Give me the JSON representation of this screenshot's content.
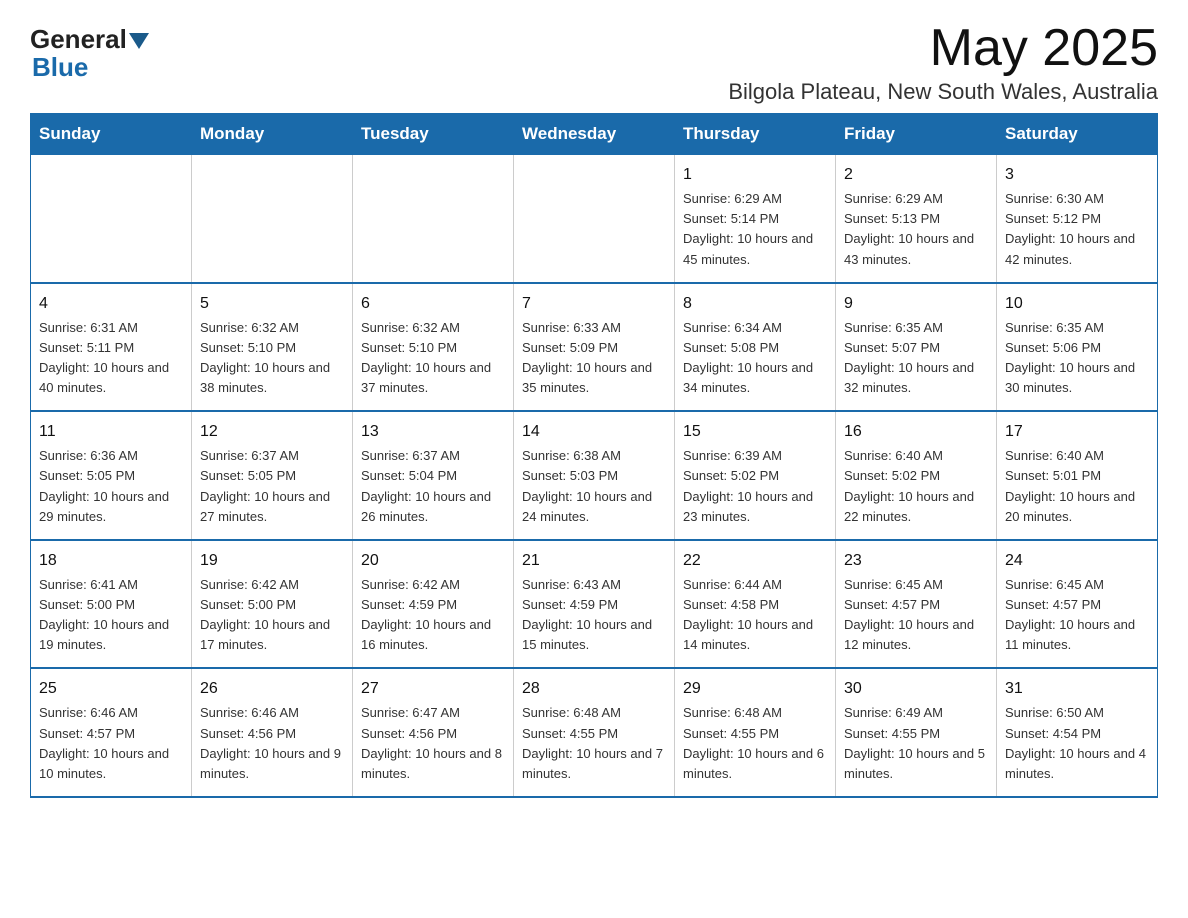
{
  "logo": {
    "general": "General",
    "blue": "Blue"
  },
  "title": {
    "month_year": "May 2025",
    "location": "Bilgola Plateau, New South Wales, Australia"
  },
  "days_of_week": [
    "Sunday",
    "Monday",
    "Tuesday",
    "Wednesday",
    "Thursday",
    "Friday",
    "Saturday"
  ],
  "weeks": [
    [
      {
        "day": "",
        "info": ""
      },
      {
        "day": "",
        "info": ""
      },
      {
        "day": "",
        "info": ""
      },
      {
        "day": "",
        "info": ""
      },
      {
        "day": "1",
        "info": "Sunrise: 6:29 AM\nSunset: 5:14 PM\nDaylight: 10 hours and 45 minutes."
      },
      {
        "day": "2",
        "info": "Sunrise: 6:29 AM\nSunset: 5:13 PM\nDaylight: 10 hours and 43 minutes."
      },
      {
        "day": "3",
        "info": "Sunrise: 6:30 AM\nSunset: 5:12 PM\nDaylight: 10 hours and 42 minutes."
      }
    ],
    [
      {
        "day": "4",
        "info": "Sunrise: 6:31 AM\nSunset: 5:11 PM\nDaylight: 10 hours and 40 minutes."
      },
      {
        "day": "5",
        "info": "Sunrise: 6:32 AM\nSunset: 5:10 PM\nDaylight: 10 hours and 38 minutes."
      },
      {
        "day": "6",
        "info": "Sunrise: 6:32 AM\nSunset: 5:10 PM\nDaylight: 10 hours and 37 minutes."
      },
      {
        "day": "7",
        "info": "Sunrise: 6:33 AM\nSunset: 5:09 PM\nDaylight: 10 hours and 35 minutes."
      },
      {
        "day": "8",
        "info": "Sunrise: 6:34 AM\nSunset: 5:08 PM\nDaylight: 10 hours and 34 minutes."
      },
      {
        "day": "9",
        "info": "Sunrise: 6:35 AM\nSunset: 5:07 PM\nDaylight: 10 hours and 32 minutes."
      },
      {
        "day": "10",
        "info": "Sunrise: 6:35 AM\nSunset: 5:06 PM\nDaylight: 10 hours and 30 minutes."
      }
    ],
    [
      {
        "day": "11",
        "info": "Sunrise: 6:36 AM\nSunset: 5:05 PM\nDaylight: 10 hours and 29 minutes."
      },
      {
        "day": "12",
        "info": "Sunrise: 6:37 AM\nSunset: 5:05 PM\nDaylight: 10 hours and 27 minutes."
      },
      {
        "day": "13",
        "info": "Sunrise: 6:37 AM\nSunset: 5:04 PM\nDaylight: 10 hours and 26 minutes."
      },
      {
        "day": "14",
        "info": "Sunrise: 6:38 AM\nSunset: 5:03 PM\nDaylight: 10 hours and 24 minutes."
      },
      {
        "day": "15",
        "info": "Sunrise: 6:39 AM\nSunset: 5:02 PM\nDaylight: 10 hours and 23 minutes."
      },
      {
        "day": "16",
        "info": "Sunrise: 6:40 AM\nSunset: 5:02 PM\nDaylight: 10 hours and 22 minutes."
      },
      {
        "day": "17",
        "info": "Sunrise: 6:40 AM\nSunset: 5:01 PM\nDaylight: 10 hours and 20 minutes."
      }
    ],
    [
      {
        "day": "18",
        "info": "Sunrise: 6:41 AM\nSunset: 5:00 PM\nDaylight: 10 hours and 19 minutes."
      },
      {
        "day": "19",
        "info": "Sunrise: 6:42 AM\nSunset: 5:00 PM\nDaylight: 10 hours and 17 minutes."
      },
      {
        "day": "20",
        "info": "Sunrise: 6:42 AM\nSunset: 4:59 PM\nDaylight: 10 hours and 16 minutes."
      },
      {
        "day": "21",
        "info": "Sunrise: 6:43 AM\nSunset: 4:59 PM\nDaylight: 10 hours and 15 minutes."
      },
      {
        "day": "22",
        "info": "Sunrise: 6:44 AM\nSunset: 4:58 PM\nDaylight: 10 hours and 14 minutes."
      },
      {
        "day": "23",
        "info": "Sunrise: 6:45 AM\nSunset: 4:57 PM\nDaylight: 10 hours and 12 minutes."
      },
      {
        "day": "24",
        "info": "Sunrise: 6:45 AM\nSunset: 4:57 PM\nDaylight: 10 hours and 11 minutes."
      }
    ],
    [
      {
        "day": "25",
        "info": "Sunrise: 6:46 AM\nSunset: 4:57 PM\nDaylight: 10 hours and 10 minutes."
      },
      {
        "day": "26",
        "info": "Sunrise: 6:46 AM\nSunset: 4:56 PM\nDaylight: 10 hours and 9 minutes."
      },
      {
        "day": "27",
        "info": "Sunrise: 6:47 AM\nSunset: 4:56 PM\nDaylight: 10 hours and 8 minutes."
      },
      {
        "day": "28",
        "info": "Sunrise: 6:48 AM\nSunset: 4:55 PM\nDaylight: 10 hours and 7 minutes."
      },
      {
        "day": "29",
        "info": "Sunrise: 6:48 AM\nSunset: 4:55 PM\nDaylight: 10 hours and 6 minutes."
      },
      {
        "day": "30",
        "info": "Sunrise: 6:49 AM\nSunset: 4:55 PM\nDaylight: 10 hours and 5 minutes."
      },
      {
        "day": "31",
        "info": "Sunrise: 6:50 AM\nSunset: 4:54 PM\nDaylight: 10 hours and 4 minutes."
      }
    ]
  ]
}
